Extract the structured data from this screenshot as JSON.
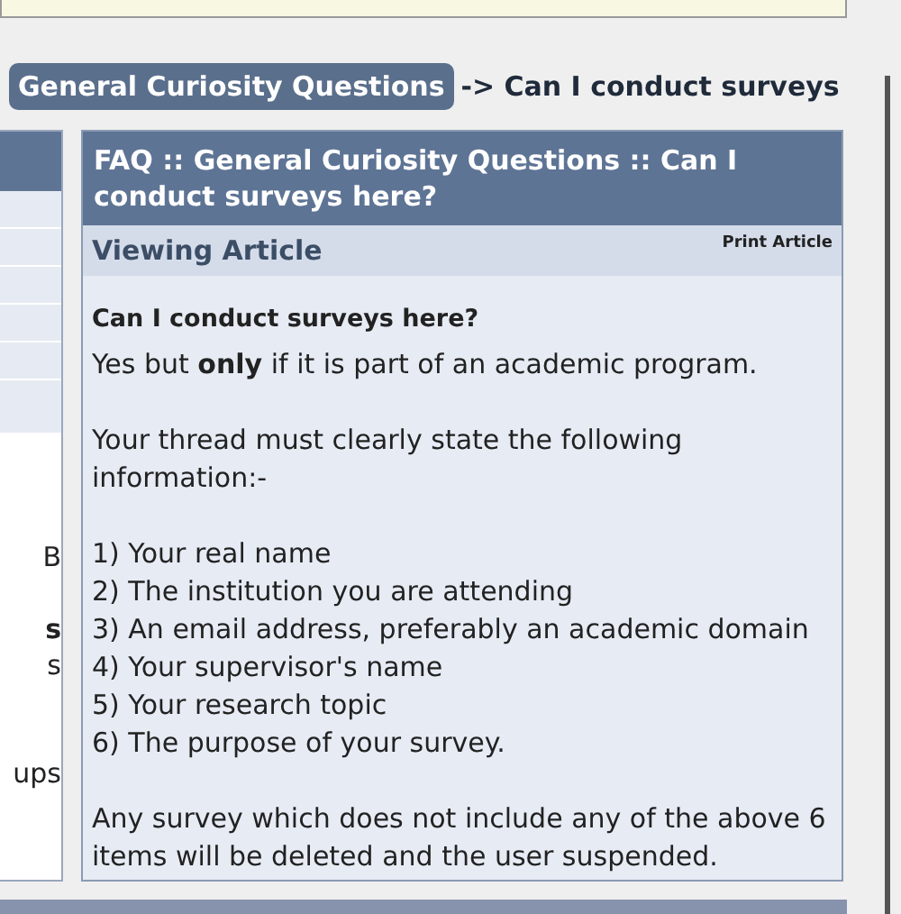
{
  "breadcrumb": {
    "category": "General Curiosity Questions",
    "separator": "->",
    "current": "Can I conduct surveys"
  },
  "sidebar": {
    "fragments": [
      {
        "text": "B",
        "bold": false
      },
      {
        "text": "s",
        "bold": true
      },
      {
        "text": "s",
        "bold": false
      },
      {
        "text": "ups",
        "bold": false
      }
    ]
  },
  "article": {
    "title": "FAQ :: General Curiosity Questions :: Can I conduct surveys here?",
    "subheader": "Viewing Article",
    "print_link": "Print Article",
    "question": "Can I conduct surveys here?",
    "blocks": [
      {
        "kind": "paragraph",
        "text": "Yes but **only** if it is part of an academic program."
      },
      {
        "kind": "paragraph",
        "text": "Your thread must clearly state the following information:-"
      },
      {
        "kind": "lines",
        "lines": [
          "1) Your real name",
          "2) The institution you are attending",
          "3) An email address, preferably an academic domain",
          "4) Your supervisor's name",
          "5) Your research topic",
          "6) The purpose of your survey."
        ]
      },
      {
        "kind": "paragraph",
        "text": "Any survey which does not include any of the above 6 items will be deleted and the user suspended."
      }
    ]
  }
}
